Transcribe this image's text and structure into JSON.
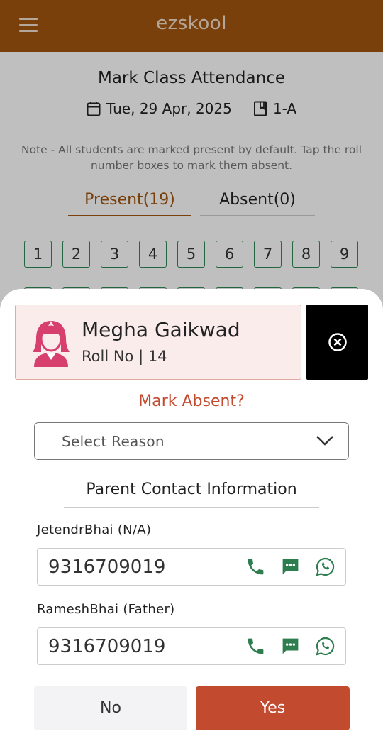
{
  "app": {
    "title": "ezskool"
  },
  "page": {
    "title": "Mark Class Attendance",
    "date": "Tue, 29 Apr, 2025",
    "class": "1-A",
    "note": "Note - All students are marked present by default. Tap the roll number boxes to mark them absent.",
    "tabs": {
      "present": "Present(19)",
      "absent": "Absent(0)"
    },
    "rolls": [
      "1",
      "2",
      "3",
      "4",
      "5",
      "6",
      "7",
      "8",
      "9"
    ]
  },
  "sheet": {
    "student": {
      "name": "Megha Gaikwad",
      "roll": "Roll No | 14"
    },
    "mark_absent": "Mark Absent?",
    "reason_placeholder": "Select Reason",
    "contact_heading": "Parent Contact Information",
    "contacts": [
      {
        "label": "JetendrBhai (N/A)",
        "phone": "9316709019"
      },
      {
        "label": "RameshBhai (Father)",
        "phone": "9316709019"
      }
    ],
    "no_label": "No",
    "yes_label": "Yes"
  },
  "colors": {
    "brand": "#a2560f",
    "accent": "#c24a2f",
    "present_box": "#2e8a55",
    "contact_icon": "#2e7d4f"
  },
  "icons": [
    "menu-icon",
    "calendar-icon",
    "book-icon",
    "student-avatar-icon",
    "close-circle-icon",
    "chevron-down-icon",
    "phone-icon",
    "sms-icon",
    "whatsapp-icon"
  ]
}
